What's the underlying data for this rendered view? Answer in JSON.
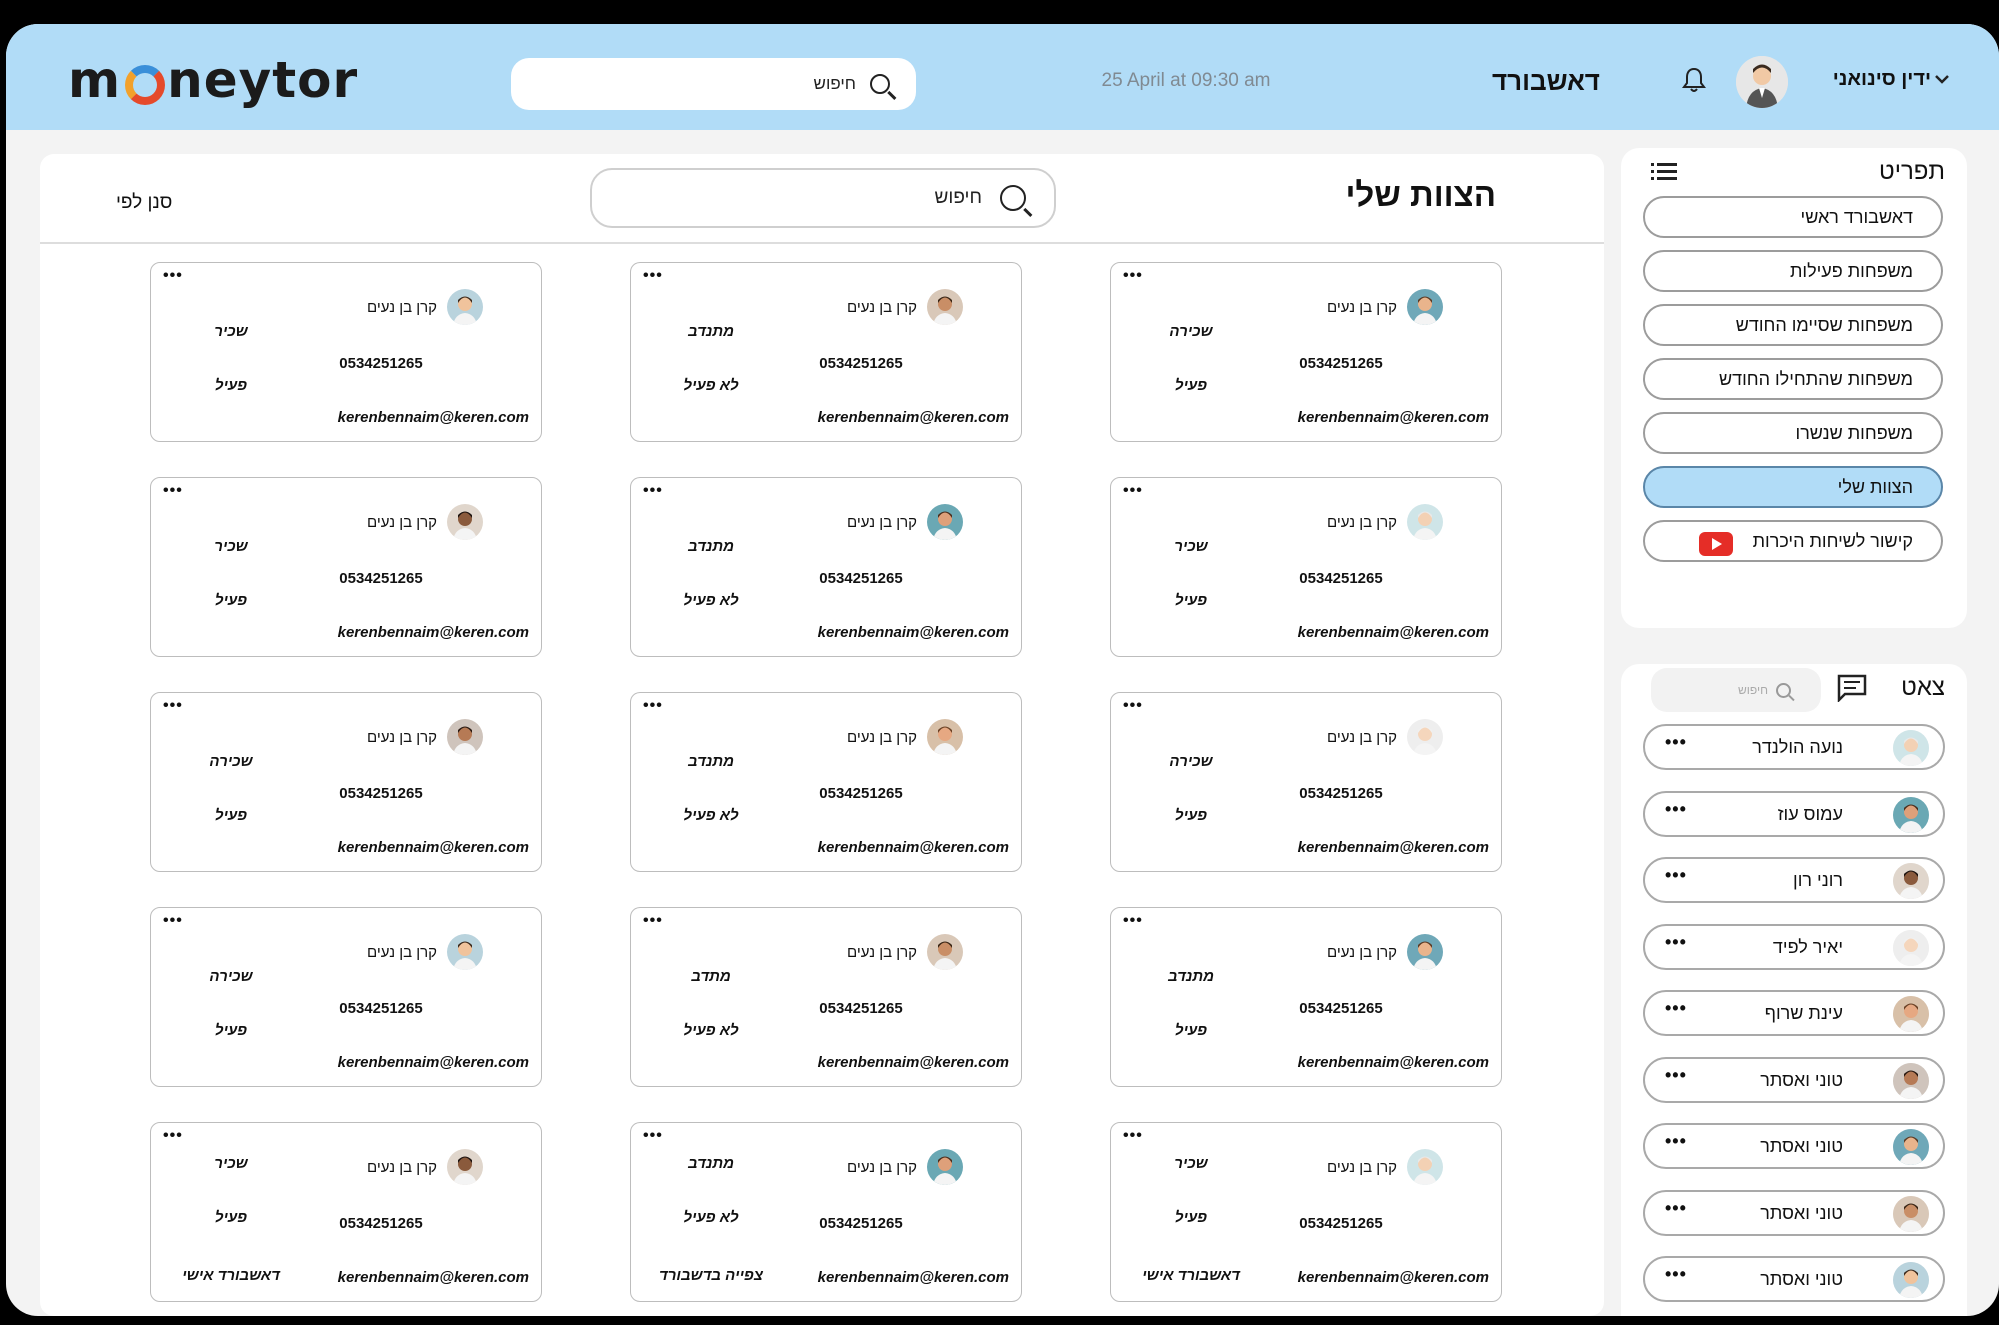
{
  "header": {
    "logo": "moneytor",
    "search_label": "חיפוש",
    "datetime": "25 April at 09:30 am",
    "dashboard_title": "דאשבורד",
    "user_name": "ידין סינואני"
  },
  "main": {
    "title": "הצוות שלי",
    "search_label": "חיפוש",
    "filter_label": "סנן לפי",
    "cards": [
      {
        "name": "קרן בן נעים",
        "phone": "0534251265",
        "email": "kerenbennaim@keren.com",
        "role": "שכירה",
        "status": "פעיל",
        "dots": "•••"
      },
      {
        "name": "קרן בן נעים",
        "phone": "0534251265",
        "email": "kerenbennaim@keren.com",
        "role": "מתנדב",
        "status": "לא פעיל",
        "dots": "•••"
      },
      {
        "name": "קרן בן נעים",
        "phone": "0534251265",
        "email": "kerenbennaim@keren.com",
        "role": "שכיר",
        "status": "פעיל",
        "dots": "•••"
      },
      {
        "name": "קרן בן נעים",
        "phone": "0534251265",
        "email": "kerenbennaim@keren.com",
        "role": "שכיר",
        "status": "פעיל",
        "dots": "•••"
      },
      {
        "name": "קרן בן נעים",
        "phone": "0534251265",
        "email": "kerenbennaim@keren.com",
        "role": "מתנדב",
        "status": "לא פעיל",
        "dots": "•••"
      },
      {
        "name": "קרן בן נעים",
        "phone": "0534251265",
        "email": "kerenbennaim@keren.com",
        "role": "שכיר",
        "status": "פעיל",
        "dots": "•••"
      },
      {
        "name": "קרן בן נעים",
        "phone": "0534251265",
        "email": "kerenbennaim@keren.com",
        "role": "שכירה",
        "status": "פעיל",
        "dots": "•••"
      },
      {
        "name": "קרן בן נעים",
        "phone": "0534251265",
        "email": "kerenbennaim@keren.com",
        "role": "מתנדב",
        "status": "לא פעיל",
        "dots": "•••"
      },
      {
        "name": "קרן בן נעים",
        "phone": "0534251265",
        "email": "kerenbennaim@keren.com",
        "role": "שכירה",
        "status": "פעיל",
        "dots": "•••"
      },
      {
        "name": "קרן בן נעים",
        "phone": "0534251265",
        "email": "kerenbennaim@keren.com",
        "role": "מתנדב",
        "status": "פעיל",
        "dots": "•••"
      },
      {
        "name": "קרן בן נעים",
        "phone": "0534251265",
        "email": "kerenbennaim@keren.com",
        "role": "מתדב",
        "status": "לא פעיל",
        "dots": "•••"
      },
      {
        "name": "קרן בן נעים",
        "phone": "0534251265",
        "email": "kerenbennaim@keren.com",
        "role": "שכירה",
        "status": "פעיל",
        "dots": "•••"
      },
      {
        "name": "קרן בן נעים",
        "phone": "0534251265",
        "email": "kerenbennaim@keren.com",
        "role": "שכיר",
        "status": "פעיל",
        "extra": "דאשבורד אישי",
        "dots": "•••"
      },
      {
        "name": "קרן בן נעים",
        "phone": "0534251265",
        "email": "kerenbennaim@keren.com",
        "role": "מתנדב",
        "status": "לא פעיל",
        "extra": "צפייה בדשבורד",
        "dots": "•••"
      },
      {
        "name": "קרן בן נעים",
        "phone": "0534251265",
        "email": "kerenbennaim@keren.com",
        "role": "שכיר",
        "status": "פעיל",
        "extra": "דאשבורד אישי",
        "dots": "•••"
      }
    ]
  },
  "menu": {
    "title": "תפריט",
    "items": [
      {
        "label": "דאשבורד ראשי"
      },
      {
        "label": "משפחות פעילות"
      },
      {
        "label": "משפחות שסיימו החודש"
      },
      {
        "label": "משפחות שהתחילו החודש"
      },
      {
        "label": "משפחות שנשרו"
      },
      {
        "label": "הצוות שלי"
      },
      {
        "label": "קישור לשיחות היכרות"
      }
    ],
    "active_index": 5
  },
  "chat": {
    "title": "צאט",
    "search_label": "חיפוש",
    "dots": "•••",
    "contacts": [
      {
        "name": "נועה הולנדר"
      },
      {
        "name": "עמוס עוז"
      },
      {
        "name": "רוני רון"
      },
      {
        "name": "יאיר לפיד"
      },
      {
        "name": "עינת שרוף"
      },
      {
        "name": "טוני ואסתר"
      },
      {
        "name": "טוני ואסתר"
      },
      {
        "name": "טוני ואסתר"
      },
      {
        "name": "טוני ואסתר"
      }
    ]
  },
  "colors": {
    "header_bg": "#b1dcf7",
    "active_menu_bg": "#b1dcf7",
    "youtube_red": "#e52d27"
  },
  "icons": {
    "search": "search-icon",
    "bell": "bell-icon",
    "chevron": "chevron-down-icon",
    "menu": "list-icon",
    "chat": "chat-bubble-icon",
    "youtube": "youtube-icon",
    "more": "more-dots-icon"
  }
}
